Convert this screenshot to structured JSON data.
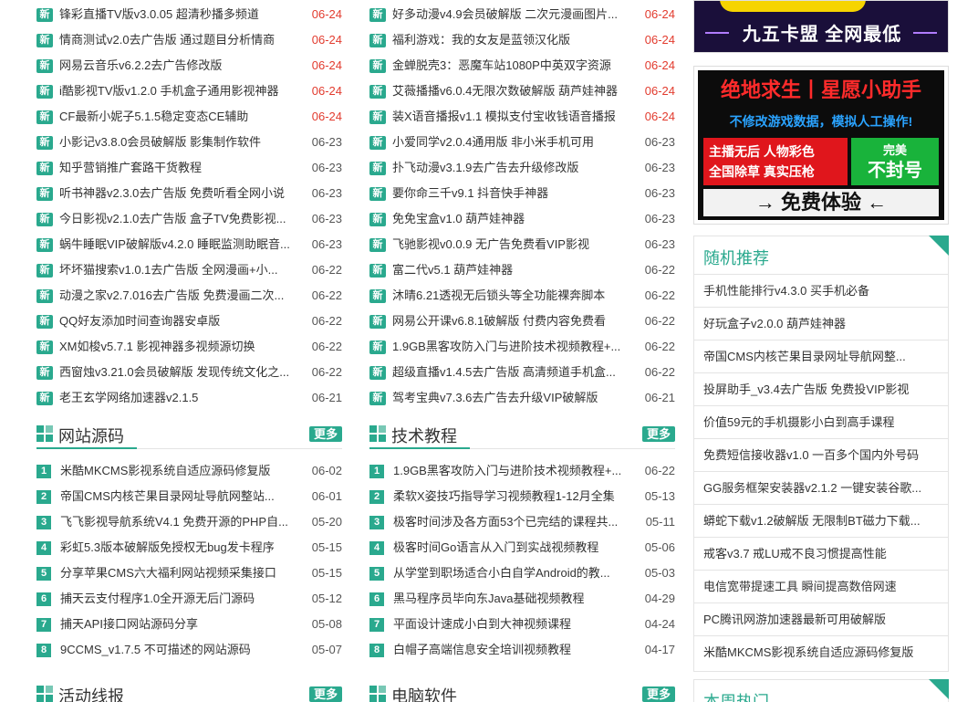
{
  "new_tag": "新",
  "more_label": "更多",
  "col1_top": [
    {
      "text": "锋彩直播TV版v3.0.05 超清秒播多频道",
      "date": "06-24",
      "hot": true
    },
    {
      "text": "情商测试v2.0去广告版 通过题目分析情商",
      "date": "06-24",
      "hot": true
    },
    {
      "text": "网易云音乐v6.2.2去广告修改版",
      "date": "06-24",
      "hot": true
    },
    {
      "text": "i酷影视TV版v1.2.0 手机盒子通用影视神器",
      "date": "06-24",
      "hot": true
    },
    {
      "text": "CF最新小妮子5.1.5稳定变态CE辅助",
      "date": "06-24",
      "hot": true
    },
    {
      "text": "小影记v3.8.0会员破解版 影集制作软件",
      "date": "06-23",
      "hot": false
    },
    {
      "text": "知乎营销推广套路干货教程",
      "date": "06-23",
      "hot": false
    },
    {
      "text": "听书神器v2.3.0去广告版 免费听看全网小说",
      "date": "06-23",
      "hot": false
    },
    {
      "text": "今日影视v2.1.0去广告版 盒子TV免费影视...",
      "date": "06-23",
      "hot": false
    },
    {
      "text": "蜗牛睡眠VIP破解版v4.2.0 睡眠监测助眠音...",
      "date": "06-23",
      "hot": false
    },
    {
      "text": "坏坏猫搜索v1.0.1去广告版 全网漫画+小...",
      "date": "06-22",
      "hot": false
    },
    {
      "text": "动漫之家v2.7.016去广告版 免费漫画二次...",
      "date": "06-22",
      "hot": false
    },
    {
      "text": "QQ好友添加时间查询器安卓版",
      "date": "06-22",
      "hot": false
    },
    {
      "text": "XM如梭v5.7.1 影视神器多视频源切换",
      "date": "06-22",
      "hot": false
    },
    {
      "text": "西窗烛v3.21.0会员破解版 发现传统文化之...",
      "date": "06-22",
      "hot": false
    },
    {
      "text": "老王玄学网络加速器v2.1.5",
      "date": "06-21",
      "hot": false
    }
  ],
  "col2_top": [
    {
      "text": "好多动漫v4.9会员破解版 二次元漫画图片...",
      "date": "06-24",
      "hot": true
    },
    {
      "text": "福利游戏：我的女友是蓝领汉化版",
      "date": "06-24",
      "hot": true
    },
    {
      "text": "金蝉脱壳3：恶魔车站1080P中英双字资源",
      "date": "06-24",
      "hot": true
    },
    {
      "text": "艾薇播播v6.0.4无限次数破解版 葫芦娃神器",
      "date": "06-24",
      "hot": true
    },
    {
      "text": "装X语音播报v1.1 模拟支付宝收钱语音播报",
      "date": "06-24",
      "hot": true
    },
    {
      "text": "小爱同学v2.0.4通用版 非小米手机可用",
      "date": "06-23",
      "hot": false
    },
    {
      "text": "扑飞动漫v3.1.9去广告去升级修改版",
      "date": "06-23",
      "hot": false
    },
    {
      "text": "要你命三千v9.1 抖音快手神器",
      "date": "06-23",
      "hot": false
    },
    {
      "text": "免免宝盒v1.0 葫芦娃神器",
      "date": "06-23",
      "hot": false
    },
    {
      "text": "飞驰影视v0.0.9 无广告免费看VIP影视",
      "date": "06-23",
      "hot": false
    },
    {
      "text": "富二代v5.1 葫芦娃神器",
      "date": "06-22",
      "hot": false
    },
    {
      "text": "沐晴6.21透视无后锁头等全功能裸奔脚本",
      "date": "06-22",
      "hot": false
    },
    {
      "text": "网易公开课v6.8.1破解版 付费内容免费看",
      "date": "06-22",
      "hot": false
    },
    {
      "text": "1.9GB黑客攻防入门与进阶技术视频教程+...",
      "date": "06-22",
      "hot": false
    },
    {
      "text": "超级直播v1.4.5去广告版 高清频道手机盒...",
      "date": "06-22",
      "hot": false
    },
    {
      "text": "驾考宝典v7.3.6去广告去升级VIP破解版",
      "date": "06-21",
      "hot": false
    }
  ],
  "sections": {
    "source": {
      "title": "网站源码",
      "items": [
        {
          "num": "1",
          "text": "米酷MKCMS影视系统自适应源码修复版",
          "date": "06-02"
        },
        {
          "num": "2",
          "text": "帝国CMS内核芒果目录网址导航网整站...",
          "date": "06-01"
        },
        {
          "num": "3",
          "text": "飞飞影视导航系统V4.1 免费开源的PHP自...",
          "date": "05-20"
        },
        {
          "num": "4",
          "text": "彩虹5.3版本破解版免授权无bug发卡程序",
          "date": "05-15"
        },
        {
          "num": "5",
          "text": "分享苹果CMS六大福利网站视频采集接口",
          "date": "05-15"
        },
        {
          "num": "6",
          "text": "捕天云支付程序1.0全开源无后门源码",
          "date": "05-12"
        },
        {
          "num": "7",
          "text": "捕天API接口网站源码分享",
          "date": "05-08"
        },
        {
          "num": "8",
          "text": "9CCMS_v1.7.5 不可描述的网站源码",
          "date": "05-07"
        }
      ]
    },
    "tutorial": {
      "title": "技术教程",
      "items": [
        {
          "num": "1",
          "text": "1.9GB黑客攻防入门与进阶技术视频教程+...",
          "date": "06-22"
        },
        {
          "num": "2",
          "text": "柔软X姿技巧指导学习视频教程1-12月全集",
          "date": "05-13"
        },
        {
          "num": "3",
          "text": "极客时间涉及各方面53个已完结的课程共...",
          "date": "05-11"
        },
        {
          "num": "4",
          "text": "极客时间Go语言从入门到实战视频教程",
          "date": "05-06"
        },
        {
          "num": "5",
          "text": "从学堂到职场适合小白自学Android的教...",
          "date": "05-03"
        },
        {
          "num": "6",
          "text": "黑马程序员毕向东Java基础视频教程",
          "date": "04-29"
        },
        {
          "num": "7",
          "text": "平面设计速成小白到大神视频课程",
          "date": "04-24"
        },
        {
          "num": "8",
          "text": "白帽子高端信息安全培训视频教程",
          "date": "04-17"
        }
      ]
    },
    "activity": {
      "title": "活动线报"
    },
    "software": {
      "title": "电脑软件"
    }
  },
  "banner1": {
    "text": "九五卡盟 全网最低"
  },
  "banner2": {
    "title": "绝地求生丨星愿小助手",
    "subtitle": "不修改游戏数据，模拟人工操作!",
    "red_line1": "主播无后 人物彩色",
    "red_line2": "全国除草 真实压枪",
    "green_line1": "完美",
    "green_line2": "不封号",
    "button": "→ 免费体验 ←"
  },
  "random": {
    "title": "随机推荐",
    "items": [
      "手机性能排行v4.3.0 买手机必备",
      "好玩盒子v2.0.0 葫芦娃神器",
      "帝国CMS内核芒果目录网址导航网整...",
      "投屏助手_v3.4去广告版 免费投VIP影视",
      "价值59元的手机摄影小白到高手课程",
      "免费短信接收器v1.0 一百多个国内外号码",
      "GG服务框架安装器v2.1.2 一键安装谷歌...",
      "蟒蛇下载v1.2破解版 无限制BT磁力下载...",
      "戒客v3.7 戒LU戒不良习惯提高性能",
      "电信宽带提速工具 瞬间提高数倍网速",
      "PC腾讯网游加速器最新可用破解版",
      "米酷MKCMS影视系统自适应源码修复版"
    ]
  },
  "weekly": {
    "title": "本周热门"
  }
}
